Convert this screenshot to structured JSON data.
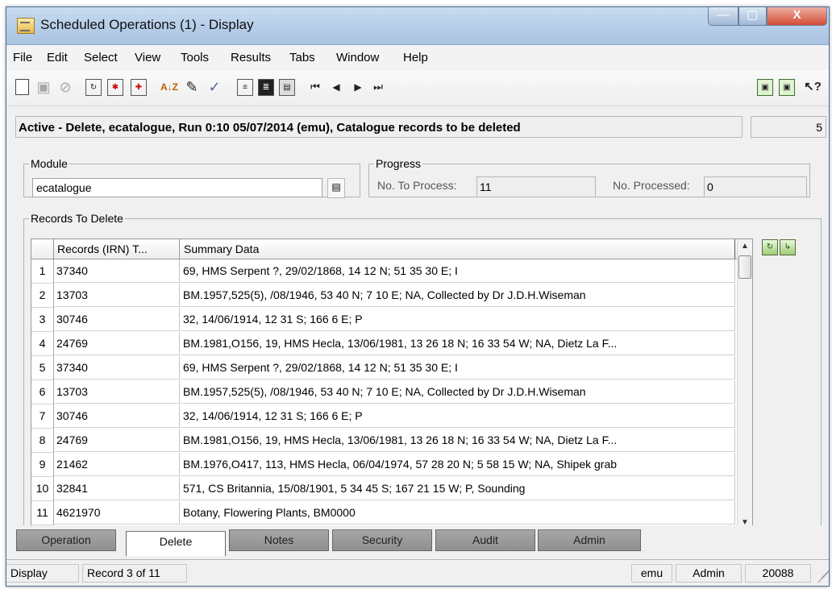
{
  "window": {
    "title": "Scheduled Operations (1) - Display",
    "controls": {
      "minimize": "—",
      "maximize": "▢",
      "close": "X"
    }
  },
  "menu": [
    "File",
    "Edit",
    "Select",
    "View",
    "Tools",
    "Results",
    "Tabs",
    "Window",
    "Help"
  ],
  "toolbar": {
    "icons": [
      "new-document-icon",
      "save-icon",
      "cancel-icon",
      "document-arrow-icon",
      "document-star-icon",
      "document-red-icon",
      "sort-az-icon",
      "edit-icon",
      "spellcheck-icon",
      "view-details-icon",
      "view-list-icon",
      "view-report-icon",
      "first-record-icon",
      "previous-record-icon",
      "next-record-icon",
      "last-record-icon",
      "attach-icon",
      "copy-record-icon",
      "context-help-icon"
    ],
    "symbols": {
      "first": "⏮",
      "previous": "◀",
      "next": "▶",
      "last": "⏭",
      "sort": "A↓Z",
      "help": "↖?"
    }
  },
  "status": {
    "text": "Active - Delete, ecatalogue, Run 0:10 05/07/2014 (emu), Catalogue records to be deleted",
    "count": "5"
  },
  "module": {
    "legend": "Module",
    "value": "ecatalogue"
  },
  "progress": {
    "legend": "Progress",
    "to_process_label": "No. To Process:",
    "to_process": "11",
    "processed_label": "No. Processed:",
    "processed": "0"
  },
  "records": {
    "legend": "Records To Delete",
    "headers": [
      "Records (IRN) T...",
      "Summary Data"
    ],
    "rows": [
      {
        "num": "1",
        "irn": "37340",
        "summary": "69, HMS Serpent ?, 29/02/1868, 14 12  N; 51 35 30 E; I"
      },
      {
        "num": "2",
        "irn": "13703",
        "summary": "BM.1957,525(5), /08/1946, 53 40  N; 7 10  E; NA, Collected by Dr J.D.H.Wiseman"
      },
      {
        "num": "3",
        "irn": "30746",
        "summary": "32, 14/06/1914, 12 31  S; 166 6  E; P"
      },
      {
        "num": "4",
        "irn": "24769",
        "summary": "BM.1981,O156, 19, HMS Hecla, 13/06/1981, 13 26 18 N; 16 33 54 W; NA, Dietz La F..."
      },
      {
        "num": "5",
        "irn": "37340",
        "summary": "69, HMS Serpent ?, 29/02/1868, 14 12  N; 51 35 30 E; I"
      },
      {
        "num": "6",
        "irn": "13703",
        "summary": "BM.1957,525(5), /08/1946, 53 40  N; 7 10  E; NA, Collected by Dr J.D.H.Wiseman"
      },
      {
        "num": "7",
        "irn": "30746",
        "summary": "32, 14/06/1914, 12 31  S; 166 6  E; P"
      },
      {
        "num": "8",
        "irn": "24769",
        "summary": "BM.1981,O156, 19, HMS Hecla, 13/06/1981, 13 26 18 N; 16 33 54 W; NA, Dietz La F..."
      },
      {
        "num": "9",
        "irn": "21462",
        "summary": "BM.1976,O417, 113, HMS Hecla, 06/04/1974, 57 28 20 N; 5 58 15 W; NA, Shipek grab"
      },
      {
        "num": "10",
        "irn": "32841",
        "summary": "571, CS Britannia, 15/08/1901, 5 34 45 S; 167 21 15 W; P, Sounding"
      },
      {
        "num": "11",
        "irn": "4621970",
        "summary": "Botany, Flowering Plants, BM0000"
      }
    ]
  },
  "tabs": [
    "Operation",
    "Delete",
    "Notes",
    "Security",
    "Audit",
    "Admin"
  ],
  "statusbar": {
    "mode": "Display",
    "record": "Record 3 of 11",
    "user": "emu",
    "group": "Admin",
    "id": "20088"
  }
}
